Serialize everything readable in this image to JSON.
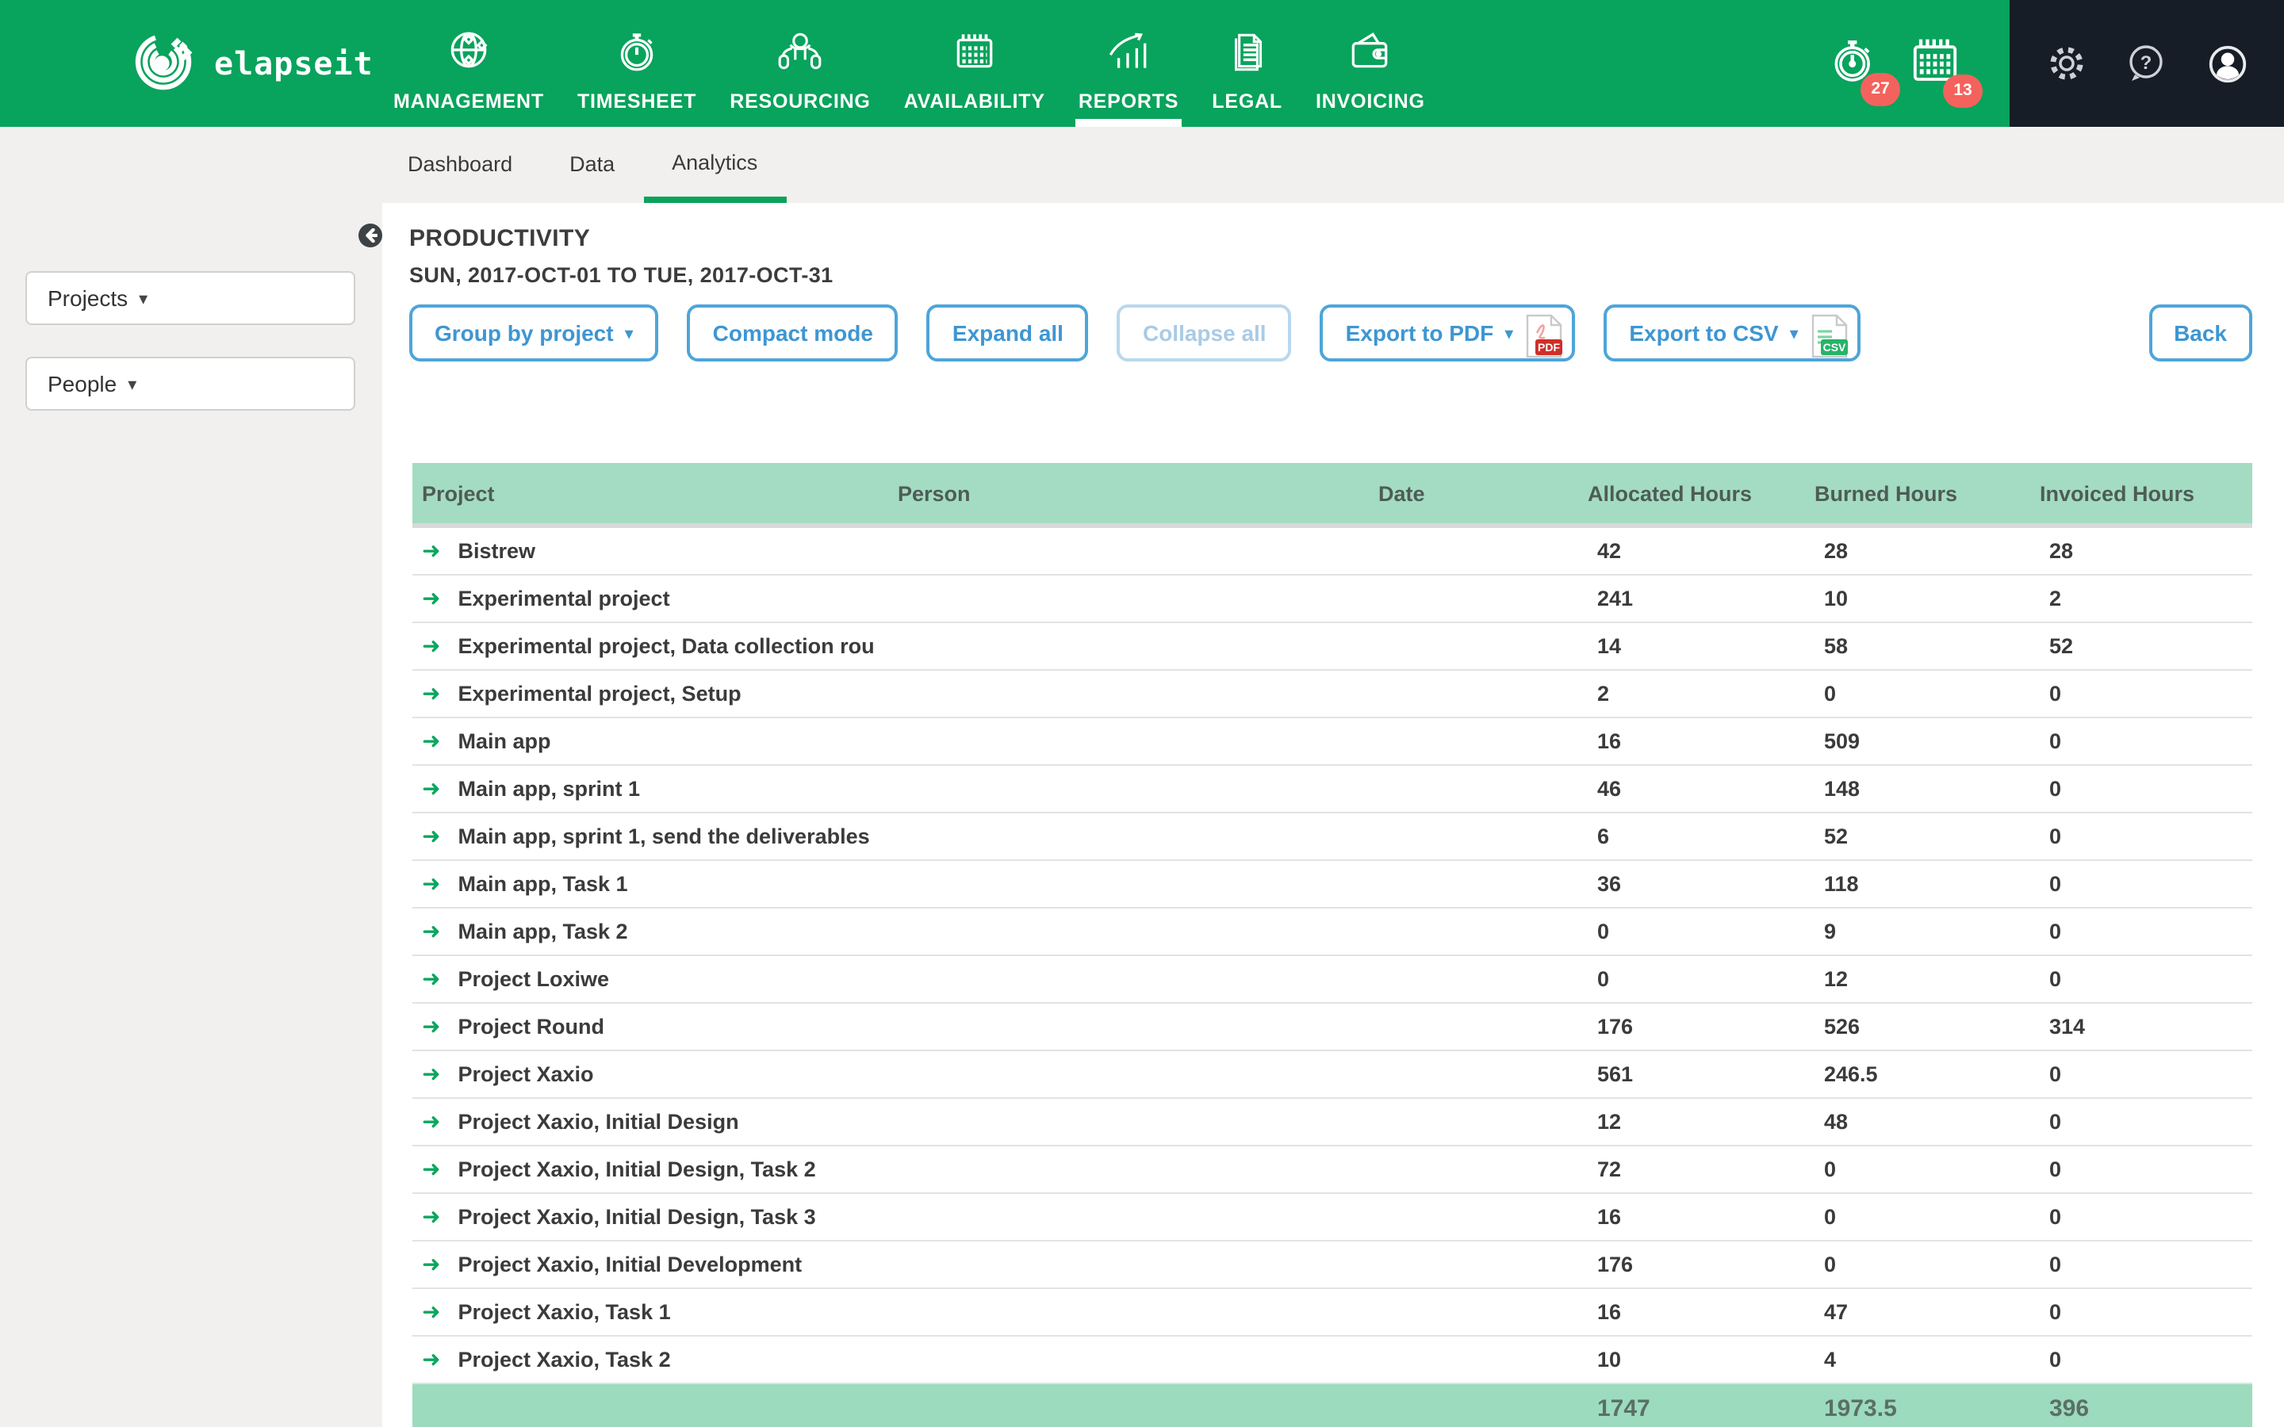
{
  "brand": {
    "name": "elapseit"
  },
  "colors": {
    "brand_green": "#08a35c",
    "dark_panel": "#161d27",
    "badge_red": "#f4625d",
    "header_green": "#a3dcc2",
    "footer_green": "#9cdbbd",
    "button_blue": "#3e96d2",
    "tab_underline": "#0ba25d",
    "arrow_green": "#0aa75e"
  },
  "icons": {
    "caret_down": "▾",
    "row_arrow": "➜"
  },
  "nav": {
    "items": [
      {
        "label": "MANAGEMENT",
        "icon": "globe-icon"
      },
      {
        "label": "TIMESHEET",
        "icon": "stopwatch-icon"
      },
      {
        "label": "RESOURCING",
        "icon": "person-resources-icon"
      },
      {
        "label": "AVAILABILITY",
        "icon": "calendar-icon"
      },
      {
        "label": "REPORTS",
        "icon": "chart-growth-icon"
      },
      {
        "label": "LEGAL",
        "icon": "documents-icon"
      },
      {
        "label": "INVOICING",
        "icon": "wallet-icon"
      }
    ],
    "active": "REPORTS"
  },
  "notifications": {
    "timer_count": "27",
    "calendar_count": "13"
  },
  "tabs": {
    "items": [
      "Dashboard",
      "Data",
      "Analytics"
    ],
    "active": "Analytics"
  },
  "filters": {
    "projects_label": "Projects",
    "people_label": "People"
  },
  "report": {
    "title": "PRODUCTIVITY",
    "date_range": "SUN, 2017-OCT-01 TO TUE, 2017-OCT-31"
  },
  "toolbar": {
    "group_by": "Group by project",
    "compact": "Compact mode",
    "expand": "Expand all",
    "collapse": "Collapse all",
    "export_pdf": "Export to PDF",
    "export_csv": "Export to CSV",
    "back": "Back",
    "pdf_badge": "PDF",
    "csv_badge": "CSV"
  },
  "table": {
    "columns": [
      "Project",
      "Person",
      "Date",
      "Allocated Hours",
      "Burned Hours",
      "Invoiced Hours"
    ],
    "rows": [
      {
        "project": "Bistrew",
        "allocated": "42",
        "burned": "28",
        "invoiced": "28"
      },
      {
        "project": "Experimental project",
        "allocated": "241",
        "burned": "10",
        "invoiced": "2"
      },
      {
        "project": "Experimental project, Data collection rou",
        "allocated": "14",
        "burned": "58",
        "invoiced": "52"
      },
      {
        "project": "Experimental project, Setup",
        "allocated": "2",
        "burned": "0",
        "invoiced": "0"
      },
      {
        "project": "Main app",
        "allocated": "16",
        "burned": "509",
        "invoiced": "0"
      },
      {
        "project": "Main app, sprint 1",
        "allocated": "46",
        "burned": "148",
        "invoiced": "0"
      },
      {
        "project": "Main app, sprint 1, send the deliverables",
        "allocated": "6",
        "burned": "52",
        "invoiced": "0"
      },
      {
        "project": "Main app, Task 1",
        "allocated": "36",
        "burned": "118",
        "invoiced": "0"
      },
      {
        "project": "Main app, Task 2",
        "allocated": "0",
        "burned": "9",
        "invoiced": "0"
      },
      {
        "project": "Project Loxiwe",
        "allocated": "0",
        "burned": "12",
        "invoiced": "0"
      },
      {
        "project": "Project Round",
        "allocated": "176",
        "burned": "526",
        "invoiced": "314"
      },
      {
        "project": "Project Xaxio",
        "allocated": "561",
        "burned": "246.5",
        "invoiced": "0"
      },
      {
        "project": "Project Xaxio, Initial Design",
        "allocated": "12",
        "burned": "48",
        "invoiced": "0"
      },
      {
        "project": "Project Xaxio, Initial Design, Task 2",
        "allocated": "72",
        "burned": "0",
        "invoiced": "0"
      },
      {
        "project": "Project Xaxio, Initial Design, Task 3",
        "allocated": "16",
        "burned": "0",
        "invoiced": "0"
      },
      {
        "project": "Project Xaxio, Initial Development",
        "allocated": "176",
        "burned": "0",
        "invoiced": "0"
      },
      {
        "project": "Project Xaxio, Task 1",
        "allocated": "16",
        "burned": "47",
        "invoiced": "0"
      },
      {
        "project": "Project Xaxio, Task 2",
        "allocated": "10",
        "burned": "4",
        "invoiced": "0"
      }
    ],
    "totals": {
      "allocated": "1747",
      "burned": "1973.5",
      "invoiced": "396"
    }
  }
}
